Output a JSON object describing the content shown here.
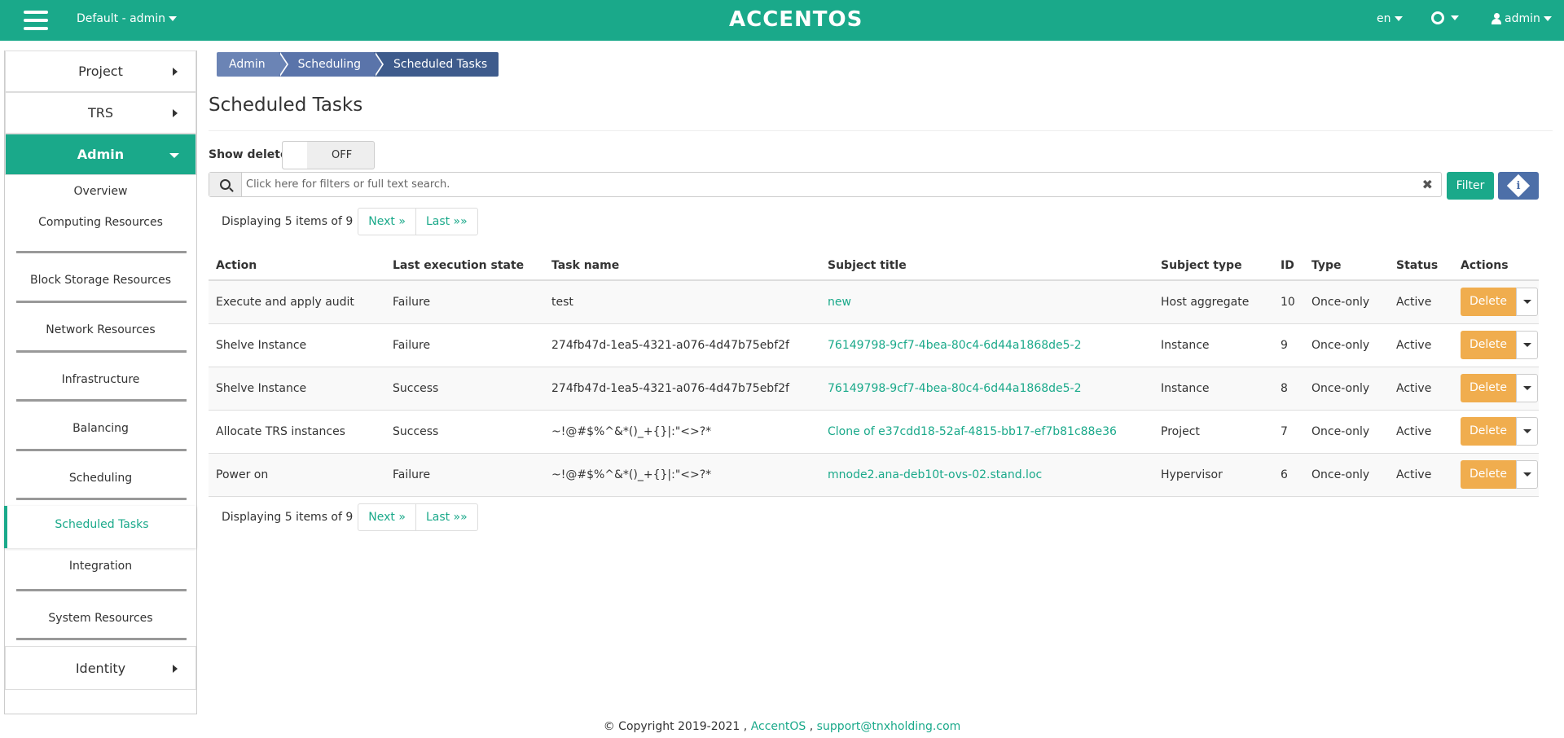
{
  "header": {
    "project": "Default - admin",
    "logo": "ACCENTOS",
    "language": "en",
    "user": "admin"
  },
  "sidebar": {
    "sections": [
      {
        "label": "Project"
      },
      {
        "label": "TRS"
      },
      {
        "label": "Admin"
      }
    ],
    "admin_items": [
      {
        "label": "Overview"
      },
      {
        "label": "Computing Resources"
      },
      {
        "label": "Block Storage Resources"
      },
      {
        "label": "Network Resources"
      },
      {
        "label": "Infrastructure"
      },
      {
        "label": "Balancing"
      },
      {
        "label": "Scheduling"
      },
      {
        "label": "Scheduled Tasks"
      },
      {
        "label": "Integration"
      },
      {
        "label": "System Resources"
      }
    ],
    "identity": "Identity"
  },
  "breadcrumb": [
    "Admin",
    "Scheduling",
    "Scheduled Tasks"
  ],
  "page_title": "Scheduled Tasks",
  "show_deleted": {
    "label": "Show deleted",
    "state": "OFF"
  },
  "search": {
    "placeholder": "Click here for filters or full text search."
  },
  "filter_label": "Filter",
  "pager": {
    "text": "Displaying 5 items of 9",
    "next": "Next »",
    "last": "Last »»"
  },
  "table": {
    "columns": [
      "Action",
      "Last execution state",
      "Task name",
      "Subject title",
      "Subject type",
      "ID",
      "Type",
      "Status",
      "Actions"
    ],
    "rows": [
      {
        "action": "Execute and apply audit",
        "state": "Failure",
        "task": "test",
        "subject": "new",
        "subject_type": "Host aggregate",
        "id": "10",
        "type": "Once-only",
        "status": "Active"
      },
      {
        "action": "Shelve Instance",
        "state": "Failure",
        "task": "274fb47d-1ea5-4321-a076-4d47b75ebf2f",
        "subject": "76149798-9cf7-4bea-80c4-6d44a1868de5-2",
        "subject_type": "Instance",
        "id": "9",
        "type": "Once-only",
        "status": "Active"
      },
      {
        "action": "Shelve Instance",
        "state": "Success",
        "task": "274fb47d-1ea5-4321-a076-4d47b75ebf2f",
        "subject": "76149798-9cf7-4bea-80c4-6d44a1868de5-2",
        "subject_type": "Instance",
        "id": "8",
        "type": "Once-only",
        "status": "Active"
      },
      {
        "action": "Allocate TRS instances",
        "state": "Success",
        "task": "~!@#$%^&*()_+{}|:\"<>?*",
        "subject": "Clone of e37cdd18-52af-4815-bb17-ef7b81c88e36",
        "subject_type": "Project",
        "id": "7",
        "type": "Once-only",
        "status": "Active"
      },
      {
        "action": "Power on",
        "state": "Failure",
        "task": "~!@#$%^&*()_+{}|:\"<>?*",
        "subject": "mnode2.ana-deb10t-ovs-02.stand.loc",
        "subject_type": "Hypervisor",
        "id": "6",
        "type": "Once-only",
        "status": "Active"
      }
    ],
    "delete_label": "Delete"
  },
  "footer": {
    "copyright": "© Copyright 2019-2021 , ",
    "brand": "AccentOS",
    "sep": " , ",
    "email": "support@tnxholding.com"
  }
}
